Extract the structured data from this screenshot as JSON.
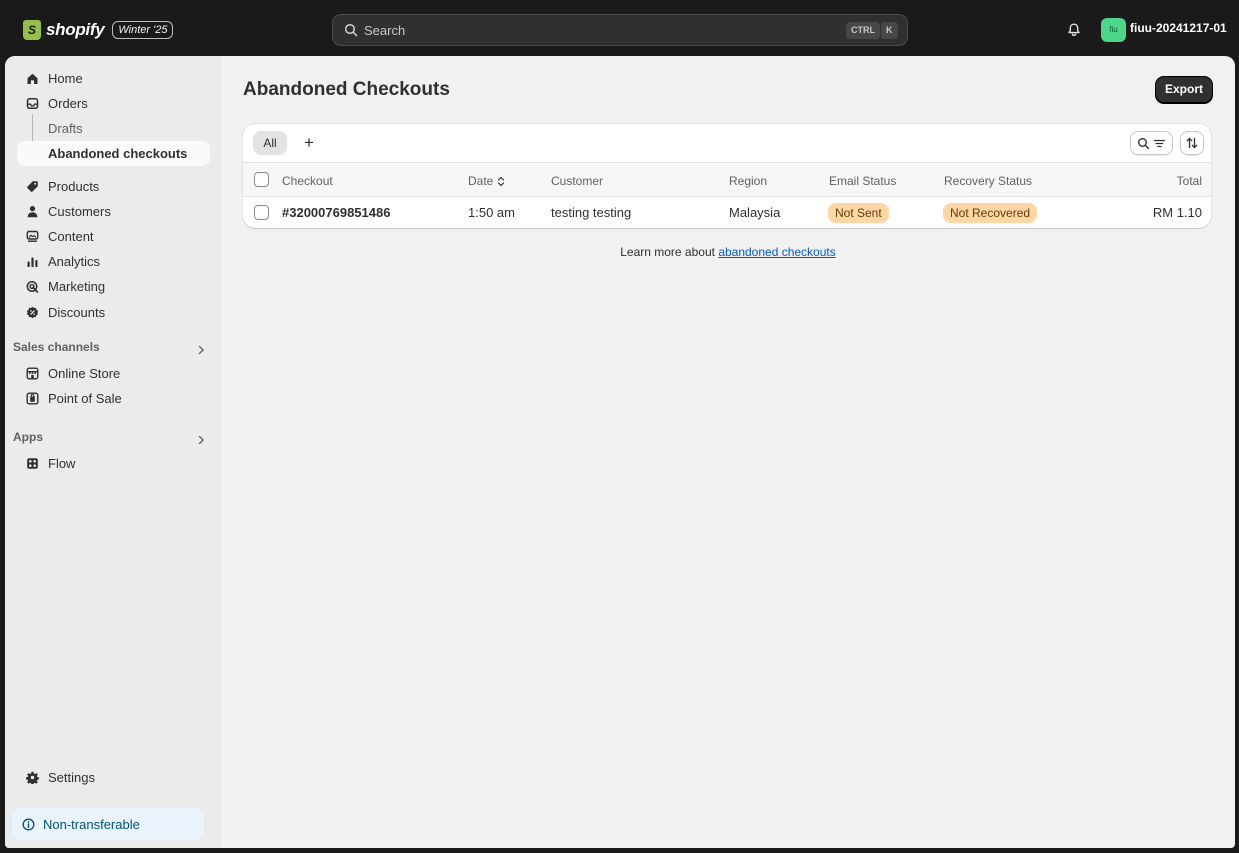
{
  "topbar": {
    "brand": "shopify",
    "edition_badge": "Winter '25",
    "search_placeholder": "Search",
    "shortcut_key1": "CTRL",
    "shortcut_key2": "K",
    "avatar_initials": "fiu",
    "store_name": "fiuu-20241217-01"
  },
  "sidebar": {
    "home": "Home",
    "orders": "Orders",
    "drafts": "Drafts",
    "abandoned_checkouts": "Abandoned checkouts",
    "products": "Products",
    "customers": "Customers",
    "content": "Content",
    "analytics": "Analytics",
    "marketing": "Marketing",
    "discounts": "Discounts",
    "sales_channels_label": "Sales channels",
    "online_store": "Online Store",
    "point_of_sale": "Point of Sale",
    "apps_label": "Apps",
    "flow": "Flow",
    "settings": "Settings",
    "non_transferable": "Non-transferable"
  },
  "page": {
    "title": "Abandoned Checkouts",
    "export_label": "Export",
    "tab_all": "All",
    "tab_add": "+",
    "columns": {
      "checkout": "Checkout",
      "date": "Date",
      "customer": "Customer",
      "region": "Region",
      "email_status": "Email Status",
      "recovery_status": "Recovery Status",
      "total": "Total"
    },
    "rows": [
      {
        "checkout": "#32000769851486",
        "date": "1:50 am",
        "customer": "testing testing",
        "region": "Malaysia",
        "email_status": "Not Sent",
        "recovery_status": "Not Recovered",
        "total": "RM 1.10"
      }
    ],
    "learn_more_text": "Learn more about",
    "learn_more_link": "abandoned checkouts"
  }
}
